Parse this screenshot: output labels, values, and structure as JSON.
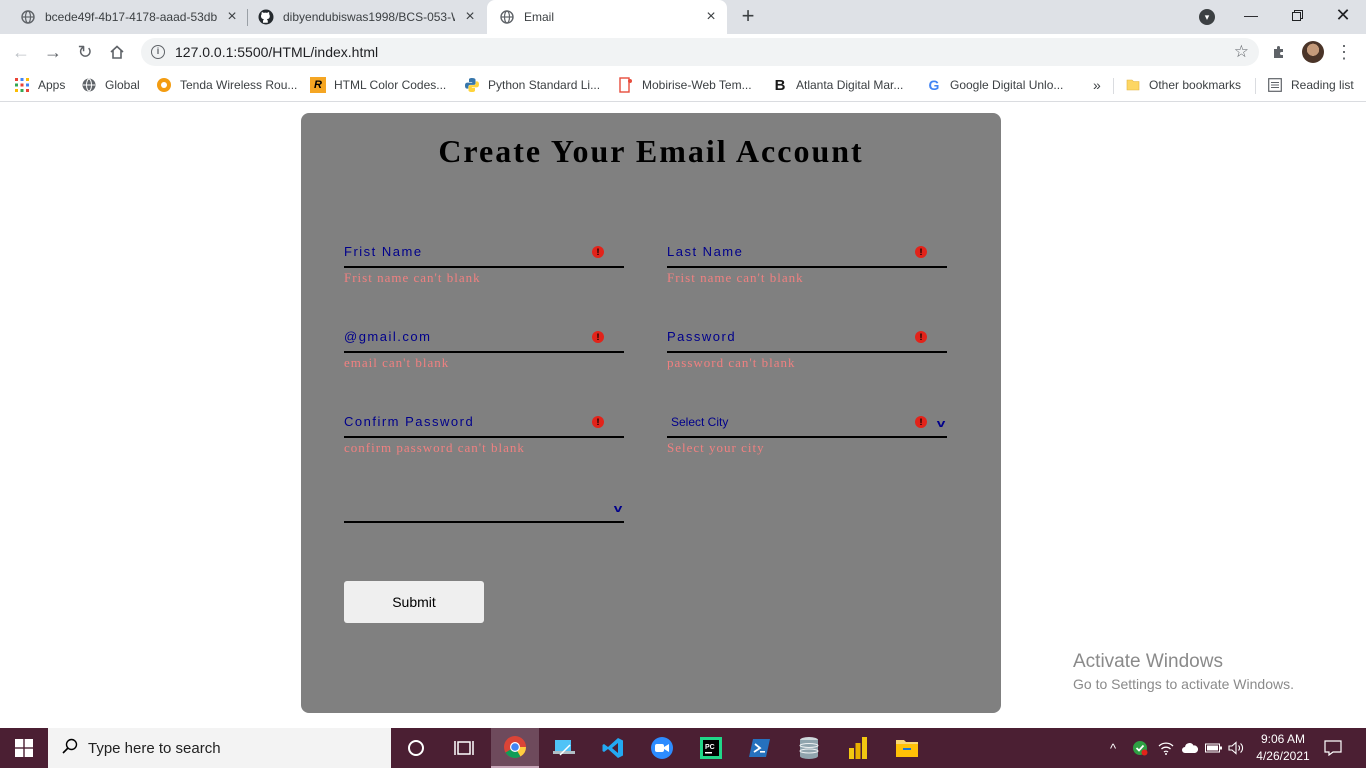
{
  "browser": {
    "tabs": [
      {
        "title": "bcede49f-4b17-4178-aaad-53db",
        "icon": "globe-icon"
      },
      {
        "title": "dibyendubiswas1998/BCS-053-W",
        "icon": "github-icon"
      },
      {
        "title": "Email",
        "icon": "globe-icon",
        "active": true
      }
    ],
    "url": "127.0.0.1:5500/HTML/index.html",
    "bookmarks": [
      {
        "label": "Apps",
        "icon": "apps-grid-icon"
      },
      {
        "label": "Global",
        "icon": "globe-icon"
      },
      {
        "label": "Tenda Wireless Rou...",
        "icon": "tenda-icon"
      },
      {
        "label": "HTML Color Codes...",
        "icon": "r-logo-icon"
      },
      {
        "label": "Python Standard Li...",
        "icon": "python-icon"
      },
      {
        "label": "Mobirise-Web Tem...",
        "icon": "mobirise-icon"
      },
      {
        "label": "Atlanta Digital Mar...",
        "icon": "b-logo-icon"
      },
      {
        "label": "Google Digital Unlo...",
        "icon": "google-icon"
      }
    ],
    "overflow": "»",
    "other_bookmarks": "Other bookmarks",
    "reading_list": "Reading list"
  },
  "form": {
    "title": "Create Your Email Account",
    "first_name": {
      "label": "Frist Name",
      "error": "Frist name can't blank"
    },
    "last_name": {
      "label": "Last Name",
      "error": "Frist name can't blank"
    },
    "email": {
      "label": "@gmail.com",
      "error": "email can't blank"
    },
    "password": {
      "label": "Password",
      "error": "password can't blank"
    },
    "confirm_password": {
      "label": "Confirm Password",
      "error": "confirm password can't blank"
    },
    "city": {
      "label": "Select City",
      "error": "Select your city"
    },
    "extra_select": {
      "label": ""
    },
    "submit": "Submit"
  },
  "watermark": {
    "line1": "Activate Windows",
    "line2": "Go to Settings to activate Windows."
  },
  "taskbar": {
    "search_placeholder": "Type here to search",
    "time": "9:06 AM",
    "date": "4/26/2021"
  },
  "colors": {
    "card_bg": "#808080",
    "label": "#00008b",
    "error_text": "#f08080",
    "error_icon": "#e2231a",
    "taskbar": "#4b1f33"
  }
}
